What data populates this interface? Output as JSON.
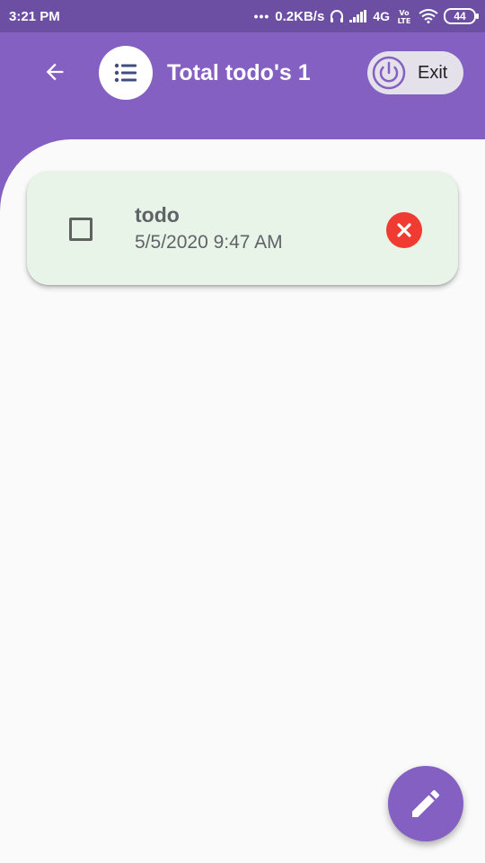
{
  "status_bar": {
    "time": "3:21 PM",
    "dots": "•••",
    "network_speed": "0.2KB/s",
    "network_type": "4G",
    "volte": "Vo LTE",
    "battery": "44",
    "icons": [
      "headphones-icon",
      "signal-icon",
      "volte-icon",
      "wifi-icon",
      "battery-icon"
    ]
  },
  "app_bar": {
    "back_icon": "arrow-left-icon",
    "list_icon": "list-icon",
    "title": "Total todo's 1",
    "exit_icon": "power-icon",
    "exit_label": "Exit"
  },
  "todos": [
    {
      "title": "todo",
      "datetime": "5/5/2020 9:47 AM",
      "checked": false,
      "delete_icon": "close-circle-icon"
    }
  ],
  "fab": {
    "icon": "pencil-icon"
  },
  "colors": {
    "primary": "#8460c2",
    "status_bar": "#6c4fa3",
    "card_bg": "#e8f4e8",
    "delete": "#ef3b31",
    "text_secondary": "#5f6368"
  }
}
